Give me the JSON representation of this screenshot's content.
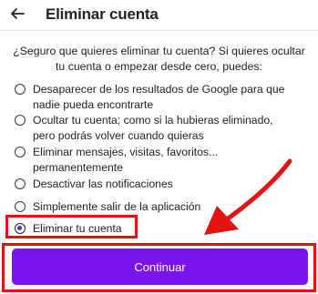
{
  "header": {
    "back_icon": "arrow-left-icon",
    "title": "Eliminar cuenta"
  },
  "question": "¿Seguro que quieres eliminar tu cuenta? Si quieres ocultar tu cuenta o empezar desde cero, puedes:",
  "options": [
    {
      "label": "Desaparecer de los resultados de Google para que nadie pueda encontrarte",
      "selected": false
    },
    {
      "label": "Ocultar tu cuenta; como si la hubieras eliminado, pero podrás volver cuando quieras",
      "selected": false
    },
    {
      "label": "Eliminar mensajes, visitas, favoritos... permanentemente",
      "selected": false
    },
    {
      "label": "Desactivar las notificaciones",
      "selected": false
    },
    {
      "label": "Simplemente salir de la aplicación",
      "selected": false
    },
    {
      "label": "Eliminar tu cuenta",
      "selected": true
    }
  ],
  "continue_label": "Continuar",
  "colors": {
    "accent": "#7b12f0",
    "annotation": "#e31313"
  }
}
